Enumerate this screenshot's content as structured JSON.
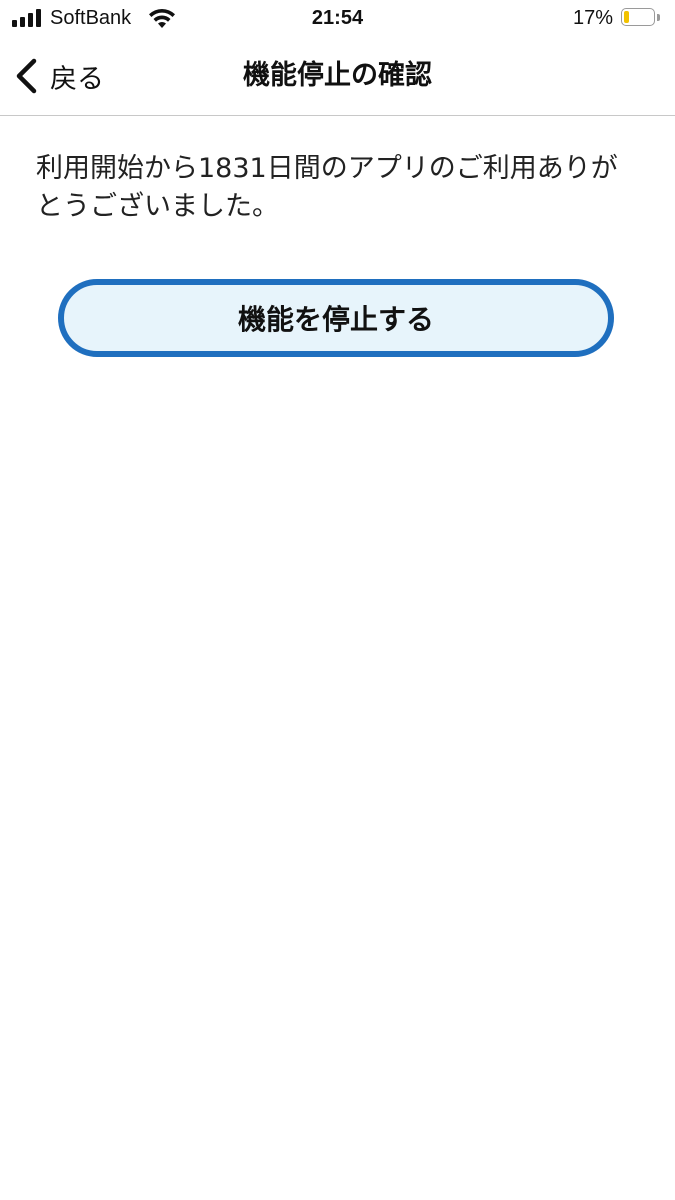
{
  "status_bar": {
    "carrier": "SoftBank",
    "time": "21:54",
    "battery_percent": "17%",
    "battery_level": 0.17,
    "battery_color": "#f2c200",
    "signal_icon": "cellular-signal-icon",
    "wifi_icon": "wifi-icon",
    "battery_icon": "battery-icon"
  },
  "nav": {
    "back_label": "戻る",
    "back_icon": "chevron-left-icon",
    "title": "機能停止の確認"
  },
  "content": {
    "message": "利用開始から1831日間のアプリのご利用ありがとうございました。",
    "stop_button_label": "機能を停止する",
    "button_border_color": "#1f6fbf",
    "button_fill_color": "#e7f4fb"
  }
}
